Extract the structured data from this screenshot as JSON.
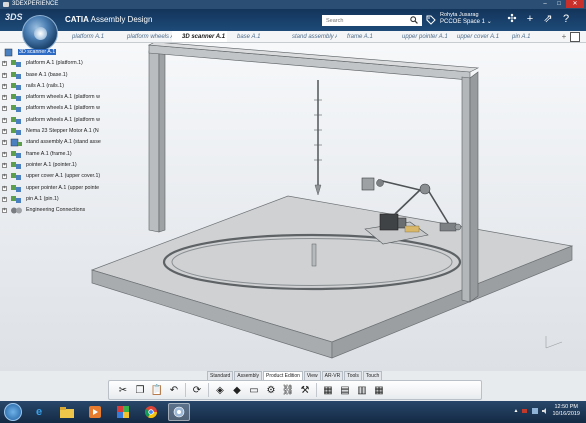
{
  "os": {
    "title": "3DEXPERIENCE",
    "buttons": {
      "minimize": "–",
      "maximize": "□",
      "close": "✕"
    }
  },
  "header": {
    "logo": "3DS",
    "app_brand": "CATIA",
    "app_name": "Assembly Design",
    "search_placeholder": "Search",
    "user_name": "Rohyta Jusarag",
    "space_label": "PCCOE Space 1 ⌄"
  },
  "tabs": [
    {
      "label": "platform A.1",
      "active": false
    },
    {
      "label": "platform wheels A",
      "active": false
    },
    {
      "label": "3D scanner A.1",
      "active": true
    },
    {
      "label": "base A.1",
      "active": false
    },
    {
      "label": "stand assembly A",
      "active": false
    },
    {
      "label": "frame A.1",
      "active": false
    },
    {
      "label": "upper pointer A.1",
      "active": false
    },
    {
      "label": "upper cover A.1",
      "active": false
    },
    {
      "label": "pin A.1",
      "active": false
    }
  ],
  "tab_add": "+",
  "tree": {
    "root": "3D scanner A.1",
    "items": [
      "platform A.1 (platform.1)",
      "base A.1 (base.1)",
      "rails A.1 (rails.1)",
      "platform wheels A.1 (platform w",
      "platform wheels A.1 (platform w",
      "platform wheels A.1 (platform w",
      "Nema 23 Stepper Motor A.1 (N",
      "stand assembly A.1 (stand asse",
      "frame A.1 (frame.1)",
      "pointer A.1 (pointer.1)",
      "upper cover A.1 (upper cover.1)",
      "upper pointer A.1 (upper pointe",
      "pin A.1 (pin.1)",
      "Engineering Connections"
    ]
  },
  "action_tabs": [
    {
      "label": "Standard",
      "active": false
    },
    {
      "label": "Assembly",
      "active": false
    },
    {
      "label": "Product Edition",
      "active": true
    },
    {
      "label": "View",
      "active": false
    },
    {
      "label": "AR-VR",
      "active": false
    },
    {
      "label": "Tools",
      "active": false
    },
    {
      "label": "Touch",
      "active": false
    }
  ],
  "actions": [
    {
      "icon": "cut-icon",
      "glyph": "✂"
    },
    {
      "icon": "copy-icon",
      "glyph": "❐"
    },
    {
      "icon": "paste-icon",
      "glyph": "📋"
    },
    {
      "icon": "undo-icon",
      "glyph": "↶"
    },
    {
      "icon": "rotate-icon",
      "glyph": "⟳"
    },
    {
      "icon": "insert-part-icon",
      "glyph": "◈"
    },
    {
      "icon": "insert-product-icon",
      "glyph": "◆"
    },
    {
      "icon": "replace-icon",
      "glyph": "▭"
    },
    {
      "icon": "flexible-icon",
      "glyph": "⚙"
    },
    {
      "icon": "engineering-connection-icon",
      "glyph": "⛓"
    },
    {
      "icon": "update-icon",
      "glyph": "⚒"
    },
    {
      "icon": "table-icon",
      "glyph": "▦"
    },
    {
      "icon": "group-icon",
      "glyph": "▤"
    },
    {
      "icon": "structure-icon",
      "glyph": "▥"
    },
    {
      "icon": "grid-icon",
      "glyph": "▦"
    }
  ],
  "taskbar": {
    "clock_time": "12:50 PM",
    "clock_date": "10/16/2019"
  },
  "colors": {
    "header": "#1d4a78",
    "selected": "#2d6ac4",
    "close": "#c9302c"
  }
}
